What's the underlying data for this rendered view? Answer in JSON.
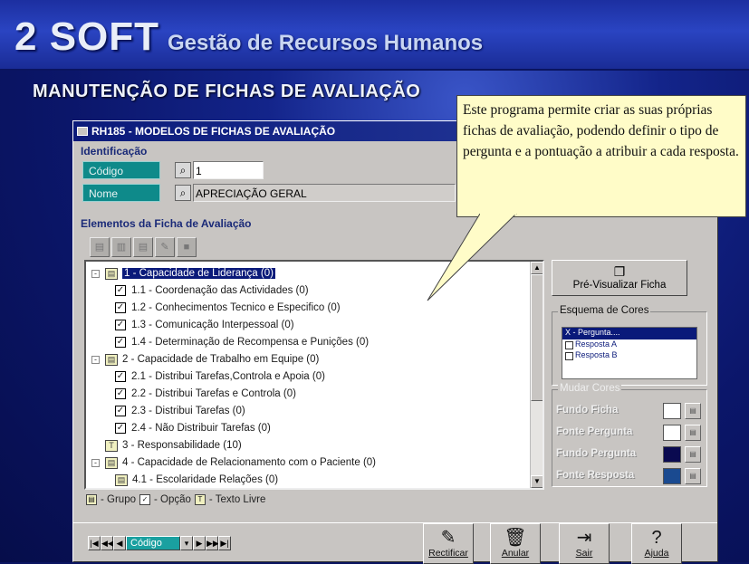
{
  "header": {
    "brand": "2 SOFT",
    "subtitle": "Gestão de Recursos Humanos",
    "page_title": "MANUTENÇÃO DE FICHAS DE AVALIAÇÃO"
  },
  "window": {
    "title": "RH185 - MODELOS DE FICHAS DE AVALIAÇÃO"
  },
  "identificacao": {
    "title": "Identificação",
    "codigo_label": "Código",
    "codigo_value": "1",
    "nome_label": "Nome",
    "nome_value": "APRECIAÇÃO GERAL"
  },
  "elementos": {
    "title": "Elementos da Ficha de Avaliação",
    "tree": [
      {
        "label": "1 - Capacidade de Liderança (0)",
        "kind": "group",
        "expand": "-",
        "level": 0,
        "selected": true
      },
      {
        "label": "1.1 - Coordenação das Actividades (0)",
        "kind": "option",
        "level": 1
      },
      {
        "label": "1.2 - Conhecimentos Tecnico e Especifico (0)",
        "kind": "option",
        "level": 1
      },
      {
        "label": "1.3 - Comunicação Interpessoal (0)",
        "kind": "option",
        "level": 1
      },
      {
        "label": "1.4 - Determinação de Recompensa e Punições (0)",
        "kind": "option",
        "level": 1
      },
      {
        "label": "2 - Capacidade de Trabalho em Equipe (0)",
        "kind": "group",
        "expand": "-",
        "level": 0
      },
      {
        "label": "2.1 - Distribui Tarefas,Controla e Apoia (0)",
        "kind": "option",
        "level": 1
      },
      {
        "label": "2.2 - Distribui Tarefas e Controla (0)",
        "kind": "option",
        "level": 1
      },
      {
        "label": "2.3 - Distribui Tarefas (0)",
        "kind": "option",
        "level": 1
      },
      {
        "label": "2.4 - Não Distribuir Tarefas (0)",
        "kind": "option",
        "level": 1
      },
      {
        "label": "3 - Responsabilidade (10)",
        "kind": "text",
        "level": 0
      },
      {
        "label": "4 - Capacidade de Relacionamento com o Paciente (0)",
        "kind": "group",
        "expand": "-",
        "level": 0
      },
      {
        "label": "4.1 - Escolaridade Relações (0)",
        "kind": "group",
        "level": 1
      }
    ],
    "legend": {
      "grupo": "- Grupo",
      "opcao": "- Opção",
      "texto": "- Texto Livre"
    }
  },
  "preview_button": "Pré-Visualizar Ficha",
  "esquema": {
    "title": "Esquema de Cores",
    "header": "X - Pergunta....",
    "resp_a": "Resposta A",
    "resp_b": "Resposta B"
  },
  "mudar_cores": {
    "title": "Mudar Cores",
    "items": [
      {
        "label": "Fundo Ficha",
        "color": "#ffffff"
      },
      {
        "label": "Fonte Pergunta",
        "color": "#ffffff"
      },
      {
        "label": "Fundo Pergunta",
        "color": "#0a0a50"
      },
      {
        "label": "Fonte Resposta",
        "color": "#1a4a90"
      }
    ]
  },
  "nav": {
    "field": "Código"
  },
  "buttons": {
    "rectificar": "Rectificar",
    "anular": "Anular",
    "sair": "Sair",
    "ajuda": "Ajuda"
  },
  "callout": {
    "text": "Este programa permite criar as suas próprias fichas de avaliação, podendo definir o tipo de pergunta e a pontuação a atribuir a cada resposta."
  }
}
